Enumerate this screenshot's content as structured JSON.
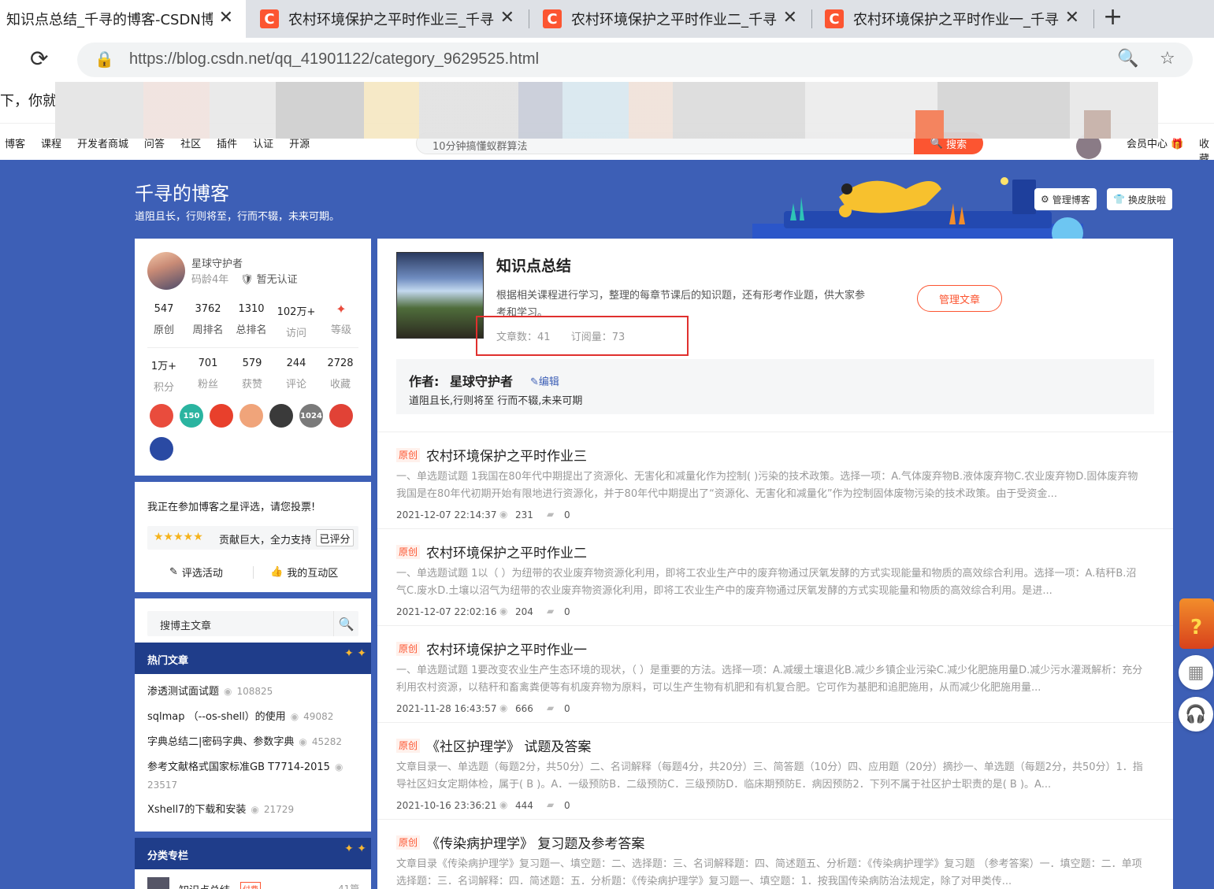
{
  "browser": {
    "tabs": [
      {
        "title": "知识点总结_千寻的博客-CSDN博",
        "active": true
      },
      {
        "title": "农村环境保护之平时作业三_千寻",
        "active": false
      },
      {
        "title": "农村环境保护之平时作业二_千寻",
        "active": false
      },
      {
        "title": "农村环境保护之平时作业一_千寻",
        "active": false
      }
    ],
    "favicon_letter": "C",
    "close_glyph": "✕",
    "newtab_glyph": "+",
    "url": "https://blog.csdn.net/qq_41901122/category_9629525.html"
  },
  "site": {
    "stray_text": "下，你就",
    "nav": [
      "博客",
      "课程",
      "开发者商城",
      "问答",
      "社区",
      "插件",
      "认证",
      "开源"
    ],
    "search_placeholder": "10分钟搞懂蚁群算法",
    "search_button": "搜索",
    "vip": "会员中心 🎁",
    "collect": "收藏"
  },
  "blog": {
    "title": "千寻的博客",
    "motto": "道阻且长，行则将至，行而不辍，未来可期。",
    "manage_blog": "管理博客",
    "change_skin": "换皮肤啦"
  },
  "profile": {
    "name": "星球守护者",
    "age": "码龄4年",
    "cert": "暂无认证",
    "stats_row1": [
      {
        "n": "547",
        "l": "原创"
      },
      {
        "n": "3762",
        "l": "周排名"
      },
      {
        "n": "1310",
        "l": "总排名"
      },
      {
        "n": "102万+",
        "l": "访问"
      },
      {
        "n": "",
        "l": "等级"
      }
    ],
    "stats_row2": [
      {
        "n": "1万+",
        "l": "积分"
      },
      {
        "n": "701",
        "l": "粉丝"
      },
      {
        "n": "579",
        "l": "获赞"
      },
      {
        "n": "244",
        "l": "评论"
      },
      {
        "n": "2728",
        "l": "收藏"
      }
    ],
    "badges": [
      {
        "label": "",
        "color": "#e94c3d"
      },
      {
        "label": "150",
        "color": "#2ab4a0"
      },
      {
        "label": "",
        "color": "#e8402c"
      },
      {
        "label": "",
        "color": "#f0a47a"
      },
      {
        "label": "",
        "color": "#3a3a3a"
      },
      {
        "label": "1024",
        "color": "#7a7a7a"
      },
      {
        "label": "",
        "color": "#e14236"
      },
      {
        "label": "",
        "color": "#2a4aa3"
      }
    ]
  },
  "vote": {
    "text": "我正在参加博客之星评选，请您投票!",
    "stars": "★★★★★",
    "message": "贡献巨大，全力支持",
    "button": "已评分",
    "link1": "评选活动",
    "link2": "我的互动区"
  },
  "sidebar_search": {
    "placeholder": "搜博主文章"
  },
  "hot": {
    "title": "热门文章",
    "items": [
      {
        "title": "渗透测试面试题",
        "views": "108825"
      },
      {
        "title": "sqlmap （--os-shell）的使用",
        "views": "49082"
      },
      {
        "title": "字典总结二|密码字典、参数字典",
        "views": "45282"
      },
      {
        "title": "参考文献格式国家标准GB T7714-2015",
        "views": "23517"
      },
      {
        "title": "Xshell7的下载和安装",
        "views": "21729"
      }
    ]
  },
  "category": {
    "title": "分类专栏",
    "first_item": "知识点总结",
    "first_item_tag": "付费",
    "first_item_count": "41篇"
  },
  "column": {
    "title": "知识点总结",
    "desc": "根据相关课程进行学习，整理的每章节课后的知识题，还有形考作业题，供大家参考和学习。",
    "article_count": "文章数：41",
    "subscribe_count": "订阅量：73",
    "manage_button": "管理文章"
  },
  "author": {
    "label": "作者:",
    "name": "星球守护者",
    "edit": "编辑",
    "motto": "道阻且长,行则将至 行而不辍,未来可期"
  },
  "articles": [
    {
      "tag": "原创",
      "title": "农村环境保护之平时作业三",
      "desc": "一、单选题试题 1我国在80年代中期提出了资源化、无害化和减量化作为控制( )污染的技术政策。选择一项：A.气体废弃物B.液体废弃物C.农业废弃物D.固体废弃物我国是在80年代初期开始有限地进行资源化，并于80年代中期提出了“资源化、无害化和减量化”作为控制固体废物污染的技术政策。由于受资金...",
      "date": "2021-12-07 22:14:37",
      "views": "231",
      "comments": "0"
    },
    {
      "tag": "原创",
      "title": "农村环境保护之平时作业二",
      "desc": "一、单选题试题 1以（ ）为纽带的农业废弃物资源化利用，即将工农业生产中的废弃物通过厌氧发酵的方式实现能量和物质的高效综合利用。选择一项：A.秸秆B.沼气C.废水D.土壤以沼气为纽带的农业废弃物资源化利用，即将工农业生产中的废弃物通过厌氧发酵的方式实现能量和物质的高效综合利用。是进...",
      "date": "2021-12-07 22:02:16",
      "views": "204",
      "comments": "0"
    },
    {
      "tag": "原创",
      "title": "农村环境保护之平时作业一",
      "desc": "一、单选题试题 1要改变农业生产生态环境的现状，（ ）是重要的方法。选择一项：A.减缓土壤退化B.减少乡镇企业污染C.减少化肥施用量D.减少污水灌溉解析：充分利用农村资源，以秸秆和畜禽粪便等有机废弃物为原料，可以生产生物有机肥和有机复合肥。它可作为基肥和追肥施用，从而减少化肥施用量...",
      "date": "2021-11-28 16:43:57",
      "views": "666",
      "comments": "0"
    },
    {
      "tag": "原创",
      "title": "《社区护理学》 试题及答案",
      "desc": "文章目录一、单选题（每题2分，共50分）二、名词解释（每题4分，共20分）三、简答题（10分）四、应用题（20分）摘抄一、单选题（每题2分，共50分）1．指导社区妇女定期体检，属于( B )。A．一级预防B．二级预防C．三级预防D．临床期预防E．病因预防2．下列不属于社区护士职责的是( B )。A...",
      "date": "2021-10-16 23:36:21",
      "views": "444",
      "comments": "0"
    },
    {
      "tag": "原创",
      "title": "《传染病护理学》 复习题及参考答案",
      "desc": "文章目录《传染病护理学》复习题一、填空题：二、选择题：三、名词解释题：四、简述题五、分析题：《传染病护理学》复习题 （参考答案）一．填空题：二．单项选择题：三．名词解释：四．简述题：五．分析题：《传染病护理学》复习题一、填空题：1．按我国传染病防治法规定，除了对甲类传...",
      "date": "",
      "views": "",
      "comments": ""
    }
  ]
}
